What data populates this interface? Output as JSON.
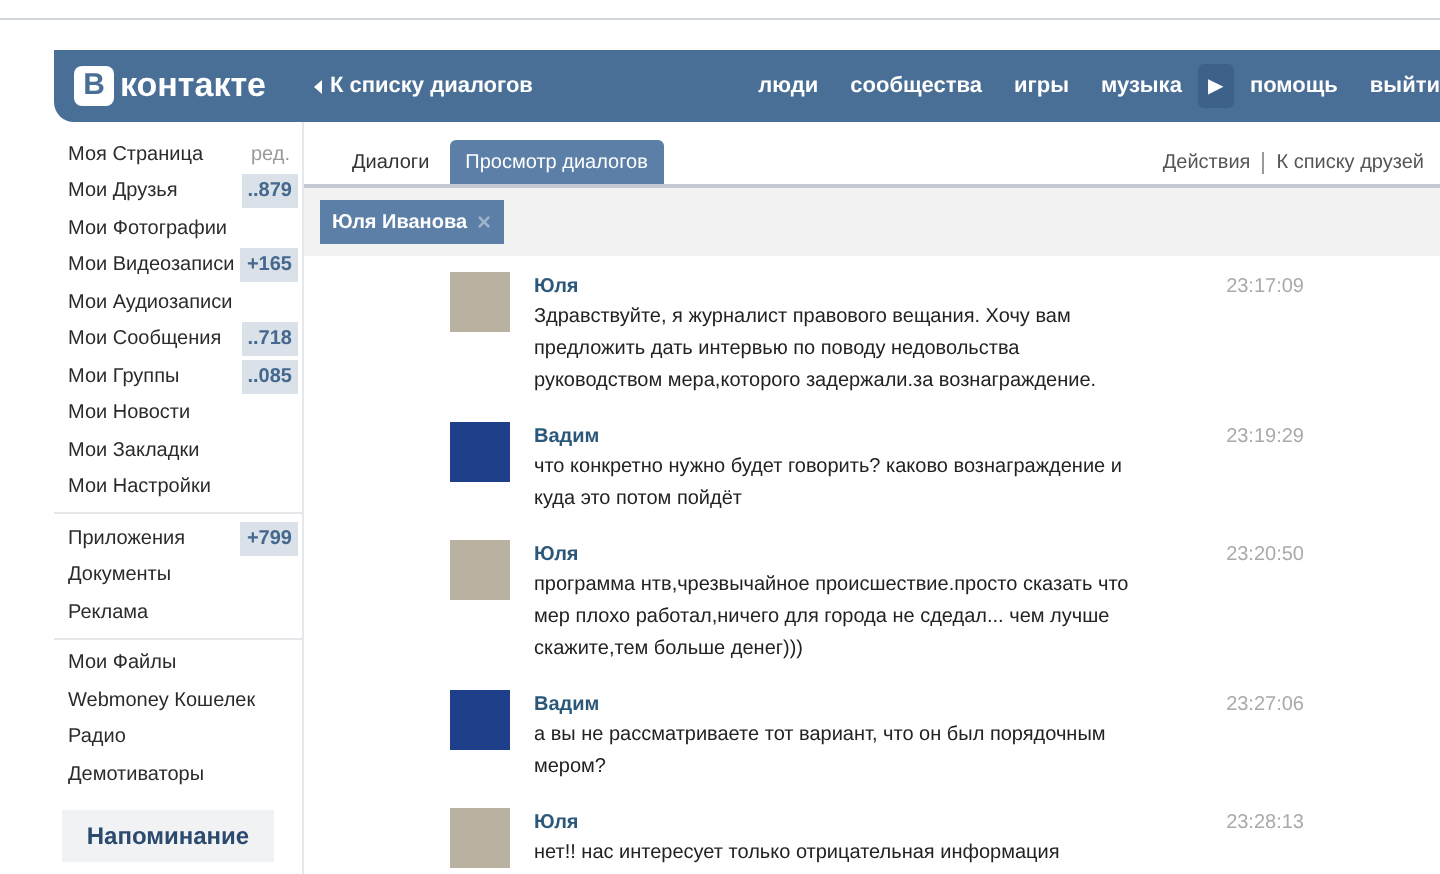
{
  "header": {
    "logo_letter": "В",
    "logo_text": "контакте",
    "back_link": "К списку диалогов",
    "nav": [
      "люди",
      "сообщества",
      "игры",
      "музыка",
      "помощь",
      "выйти"
    ],
    "play_glyph": "▶"
  },
  "sidebar": {
    "sections": [
      [
        {
          "label": "Моя Страница",
          "edit": "ред."
        },
        {
          "label": "Мои Друзья",
          "badge": "..879"
        },
        {
          "label": "Мои Фотографии"
        },
        {
          "label": "Мои Видеозаписи",
          "badge": "+165"
        },
        {
          "label": "Мои Аудиозаписи"
        },
        {
          "label": "Мои Сообщения",
          "badge": "..718"
        },
        {
          "label": "Мои Группы",
          "badge": "..085"
        },
        {
          "label": "Мои Новости"
        },
        {
          "label": "Мои Закладки"
        },
        {
          "label": "Мои Настройки"
        }
      ],
      [
        {
          "label": "Приложения",
          "badge": "+799"
        },
        {
          "label": "Документы"
        },
        {
          "label": "Реклама"
        }
      ],
      [
        {
          "label": "Мои Файлы"
        },
        {
          "label": "Webmoney Кошелек"
        },
        {
          "label": "Радио"
        },
        {
          "label": "Демотиваторы"
        }
      ]
    ],
    "reminder": "Напоминание"
  },
  "tabs": [
    {
      "label": "Диалоги",
      "selected": false
    },
    {
      "label": "Просмотр диалогов",
      "selected": true
    }
  ],
  "actions": [
    "Действия",
    "К списку друзей"
  ],
  "chip": {
    "label": "Юля Иванова",
    "close": "×"
  },
  "messages": [
    {
      "author": "Юля",
      "color": "#b9b2a0",
      "time": "23:17:09",
      "text": "Здравствуйте, я журналист правового вещания. Хочу вам предложить дать интервью по поводу недовольства руководством мера,которого задержали.за вознаграждение."
    },
    {
      "author": "Вадим",
      "color": "#1f3f8a",
      "time": "23:19:29",
      "text": "что конкретно нужно будет говорить? каково вознаграждение и куда это потом пойдёт"
    },
    {
      "author": "Юля",
      "color": "#b9b2a0",
      "time": "23:20:50",
      "text": "программа нтв,чрезвычайное происшествие.просто сказать что мер плохо работал,ничего для города не сдедал... чем лучше скажите,тем больше денег)))"
    },
    {
      "author": "Вадим",
      "color": "#1f3f8a",
      "time": "23:27:06",
      "text": "а вы не рассматриваете тот вариант, что он был порядочным мером?"
    },
    {
      "author": "Юля",
      "color": "#b9b2a0",
      "time": "23:28:13",
      "text": "нет!! нас интересует только отрицательная информация"
    }
  ]
}
